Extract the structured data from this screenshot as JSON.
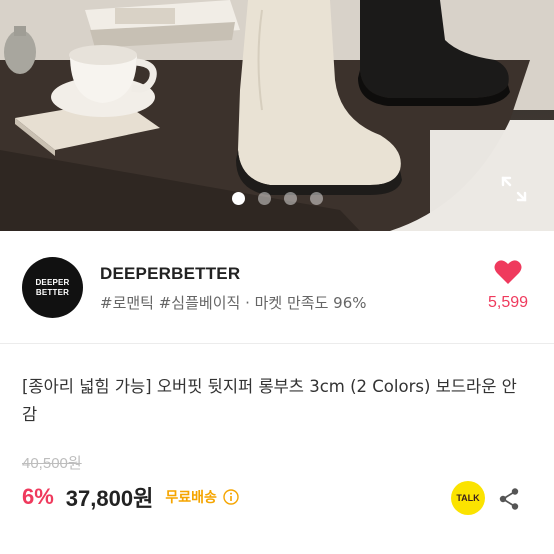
{
  "carousel": {
    "slides": 4,
    "active_index": 0
  },
  "store": {
    "logo_line1": "DEEPER",
    "logo_line2": "BETTER",
    "name": "DEEPERBETTER",
    "tags": "#로맨틱 #심플베이직 · 마켓 만족도 96%",
    "like_count": "5,599"
  },
  "product": {
    "title": "[종아리 넓힘 가능] 오버핏 뒷지퍼 롱부츠 3cm (2 Colors) 보드라운 안감",
    "original_price": "40,500원",
    "discount": "6%",
    "price": "37,800원",
    "shipping": "무료배송",
    "talk_label": "TALK"
  },
  "colors": {
    "accent": "#ef3a5d",
    "shipping": "#f5a500",
    "talk_bg": "#fbe300"
  },
  "icons": [
    "expand-icon",
    "heart-icon",
    "info-icon",
    "talk-icon",
    "share-icon"
  ]
}
